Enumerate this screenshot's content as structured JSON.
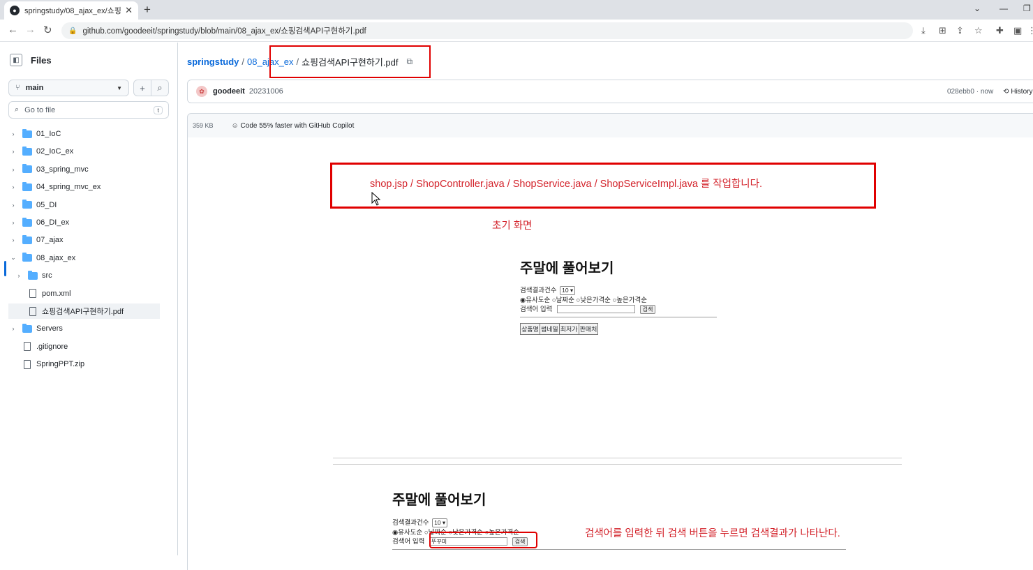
{
  "browser": {
    "tab_title": "springstudy/08_ajax_ex/쇼핑검",
    "tab_close": "✕",
    "new_tab": "+",
    "url": "github.com/goodeeit/springstudy/blob/main/08_ajax_ex/쇼핑검색API구현하기.pdf"
  },
  "sidebar": {
    "title": "Files",
    "branch": "main",
    "goto_placeholder": "Go to file",
    "goto_shortcut": "t",
    "tree": [
      {
        "label": "01_IoC",
        "type": "folder",
        "expanded": false
      },
      {
        "label": "02_IoC_ex",
        "type": "folder",
        "expanded": false
      },
      {
        "label": "03_spring_mvc",
        "type": "folder",
        "expanded": false
      },
      {
        "label": "04_spring_mvc_ex",
        "type": "folder",
        "expanded": false
      },
      {
        "label": "05_DI",
        "type": "folder",
        "expanded": false
      },
      {
        "label": "06_DI_ex",
        "type": "folder",
        "expanded": false
      },
      {
        "label": "07_ajax",
        "type": "folder",
        "expanded": false
      },
      {
        "label": "08_ajax_ex",
        "type": "folder",
        "expanded": true
      },
      {
        "label": "src",
        "type": "folder",
        "expanded": false
      },
      {
        "label": "pom.xml",
        "type": "file"
      },
      {
        "label": "쇼핑검색API구현하기.pdf",
        "type": "file",
        "selected": true
      },
      {
        "label": "Servers",
        "type": "folder",
        "expanded": false
      },
      {
        "label": ".gitignore",
        "type": "file"
      },
      {
        "label": "SpringPPT.zip",
        "type": "file"
      }
    ]
  },
  "breadcrumb": {
    "repo": "springstudy",
    "folder": "08_ajax_ex",
    "sep": "/",
    "file": "쇼핑검색API구현하기.pdf"
  },
  "commit": {
    "author": "goodeeit",
    "message": "20231006",
    "sha_time": "028ebb0 · now",
    "history": "History"
  },
  "file_header": {
    "size": "359 KB",
    "copilot": "Code 55% faster with GitHub Copilot"
  },
  "pdf": {
    "instruction": "shop.jsp  /  ShopController.java  /  ShopService.java  /  ShopServiceImpl.java 를 작업합니다.",
    "initial_screen": "초기 화면",
    "mock_title": "주말에 풀어보기",
    "result_count_label": "검색결과건수",
    "result_count_value": "10 ▾",
    "sort_options": "◉유사도순 ○날짜순 ○낮은가격순 ○높은가격순",
    "query_label": "검색어 입력",
    "search_button": "검색",
    "table_headers": [
      "상품명",
      "썸네일",
      "최저가",
      "판매처"
    ],
    "query_value": "뚜꾸미",
    "after_search_note": "검색어를 입력한 뒤 검색 버튼을 누르면 검색결과가 나타난다."
  }
}
